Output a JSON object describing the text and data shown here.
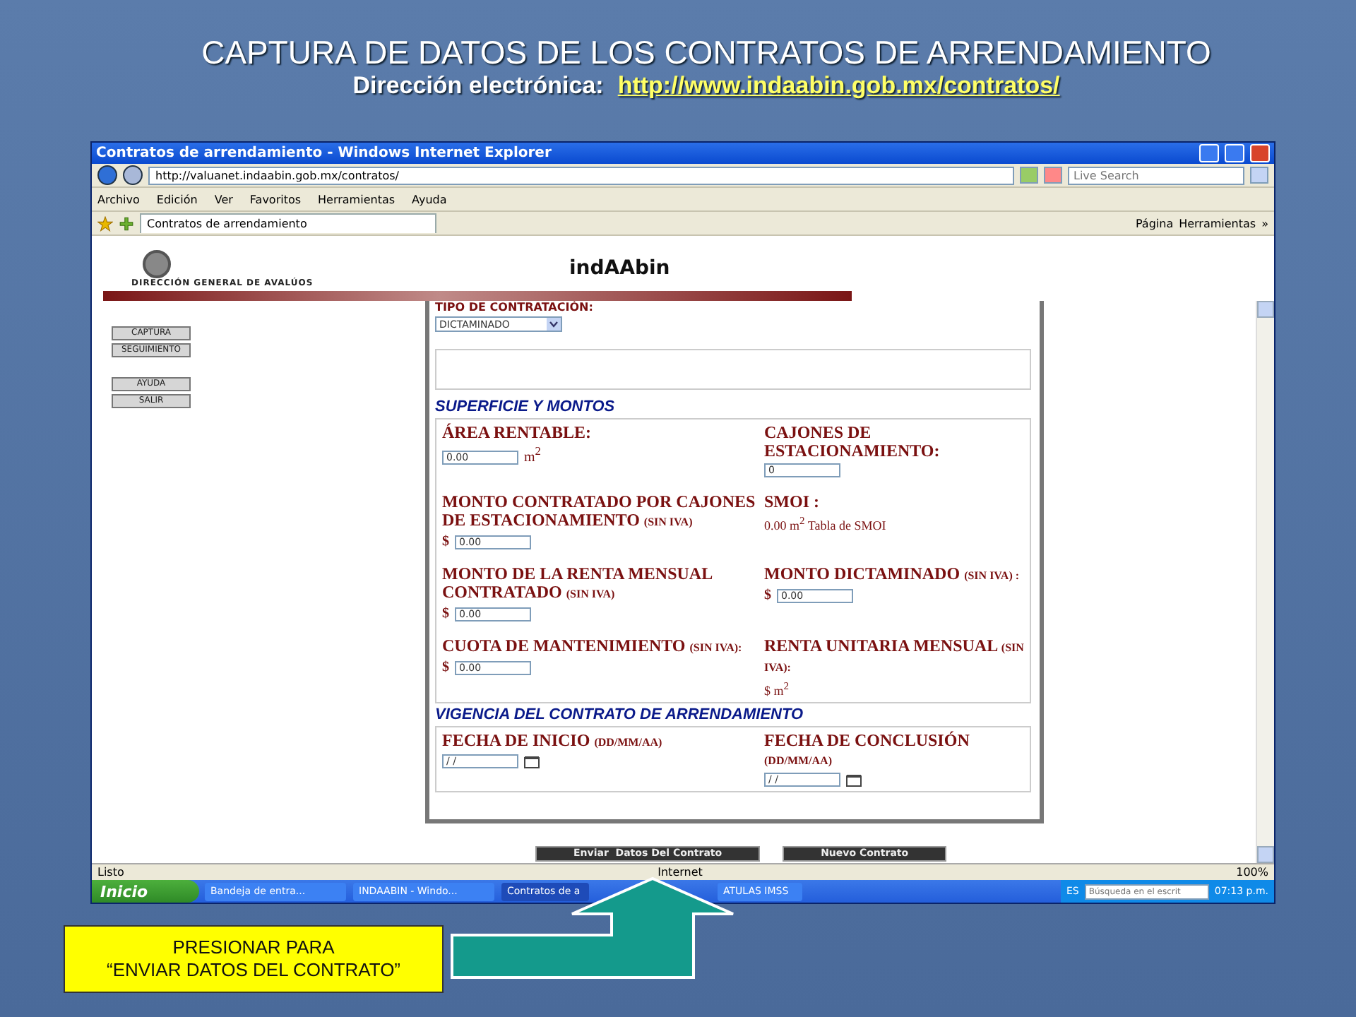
{
  "slide": {
    "title": "CAPTURA DE DATOS DE LOS CONTRATOS DE ARRENDAMIENTO",
    "subtitle_label": "Dirección electrónica:",
    "subtitle_link": "http://www.indaabin.gob.mx/contratos/"
  },
  "browser": {
    "title": "Contratos de arrendamiento - Windows Internet Explorer",
    "address": "http://valuanet.indaabin.gob.mx/contratos/",
    "search_placeholder": "Live Search",
    "menu": [
      "Archivo",
      "Edición",
      "Ver",
      "Favoritos",
      "Herramientas",
      "Ayuda"
    ],
    "tab": "Contratos de arrendamiento",
    "toolbar": [
      "Página",
      "Herramientas"
    ],
    "more": "»"
  },
  "page": {
    "org": "DIRECCIÓN GENERAL DE AVALÚOS",
    "logo": "indAAbin",
    "nav_groups": [
      [
        "CAPTURA",
        "SEGUIMIENTO"
      ],
      [
        "AYUDA",
        "SALIR"
      ]
    ],
    "contract_type_label": "TIPO DE CONTRATACIÓN:",
    "contract_type": "DICTAMINADO",
    "section_1": "SUPERFICIE Y MONTOS",
    "fields": [
      {
        "kind": "input",
        "label": "ÁREA RENTABLE:",
        "value": "0.00",
        "unit": "m$^{2}$"
      },
      {
        "kind": "input",
        "label": "CAJONES DE ESTACIONAMIENTO:",
        "value": "0"
      },
      {
        "kind": "input",
        "label": "MONTO CONTRATADO POR CAJONES DE ESTACIONAMIENTO",
        "note": "(SIN IVA)",
        "prefix": "$",
        "value": "0.00"
      },
      {
        "kind": "text",
        "label": "SMOI :",
        "text": "0.00 m$^{2}$ Tabla de SMOI"
      },
      {
        "kind": "input",
        "label": "MONTO DE LA RENTA MENSUAL CONTRATADO",
        "note": "(SIN IVA)",
        "prefix": "$",
        "value": "0.00"
      },
      {
        "kind": "input",
        "label": "MONTO DICTAMINADO",
        "note": "(SIN IVA) :",
        "prefix": "$",
        "value": "0.00"
      },
      {
        "kind": "input",
        "label": "CUOTA DE MANTENIMIENTO",
        "note": "(SIN IVA):",
        "prefix": "$",
        "value": "0.00"
      },
      {
        "kind": "text",
        "label": "RENTA UNITARIA MENSUAL",
        "note": "(SIN IVA):",
        "text": "$ m$^{2}$"
      }
    ],
    "section_2": "VIGENCIA DEL CONTRATO DE ARRENDAMIENTO",
    "dates": [
      {
        "label": "FECHA DE INICIO",
        "note": "(DD/MM/AA)",
        "value": "/ /"
      },
      {
        "label": "FECHA DE CONCLUSIÓN",
        "note": "(DD/MM/AA)",
        "value": "/ /"
      }
    ],
    "buttons": [
      "Enviar  Datos Del Contrato",
      "Nuevo Contrato"
    ]
  },
  "status_bar": {
    "status": "Listo",
    "zone": "Internet",
    "zoom": "100%"
  },
  "taskbar": {
    "start": "Inicio",
    "items": [
      {
        "label": "Bandeja de entra...",
        "selected": false
      },
      {
        "label": "INDAABIN - Windo...",
        "selected": false
      },
      {
        "label": "Contratos de a",
        "selected": true
      },
      {
        "label": "ATULAS IMSS",
        "selected": false
      }
    ],
    "lang": "ES",
    "search_placeholder": "Búsqueda en el escrit",
    "time": "07:13 p.m."
  },
  "callout": {
    "lines": [
      "PRESIONAR PARA",
      "“ENVIAR DATOS DEL CONTRATO”"
    ]
  }
}
